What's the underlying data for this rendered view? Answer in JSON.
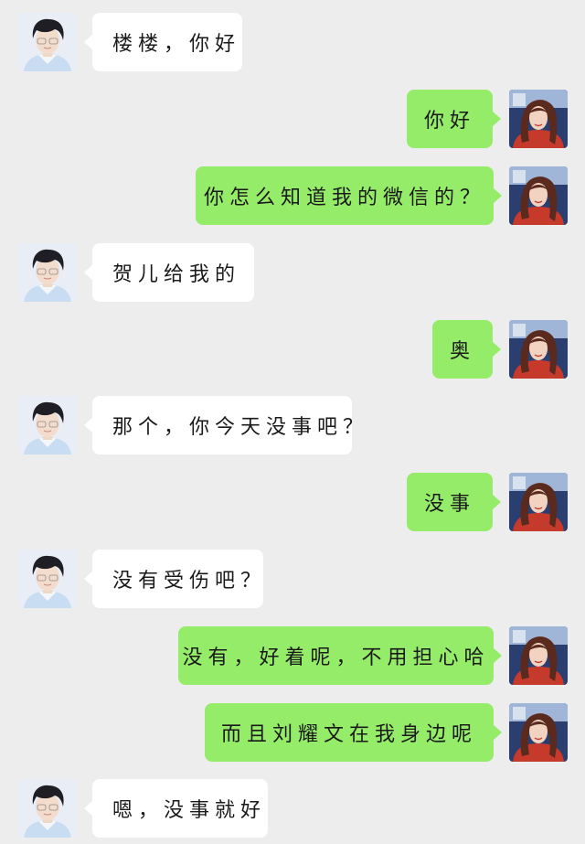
{
  "messages": [
    {
      "side": "in",
      "text": "楼楼，你好"
    },
    {
      "side": "out",
      "text": "你好"
    },
    {
      "side": "out",
      "text": "你怎么知道我的微信的？"
    },
    {
      "side": "in",
      "text": "贺儿给我的"
    },
    {
      "side": "out",
      "text": "奥"
    },
    {
      "side": "in",
      "text": "那个，你今天没事吧？"
    },
    {
      "side": "out",
      "text": "没事"
    },
    {
      "side": "in",
      "text": "没有受伤吧？"
    },
    {
      "side": "out",
      "text": "没有，好着呢，不用担心哈"
    },
    {
      "side": "out",
      "text": "而且刘耀文在我身边呢"
    },
    {
      "side": "in",
      "text": "嗯，没事就好"
    }
  ],
  "avatars": {
    "in": "male-contact-avatar",
    "out": "female-self-avatar"
  },
  "colors": {
    "background": "#ededed",
    "incoming_bubble": "#ffffff",
    "outgoing_bubble": "#95ec69"
  }
}
